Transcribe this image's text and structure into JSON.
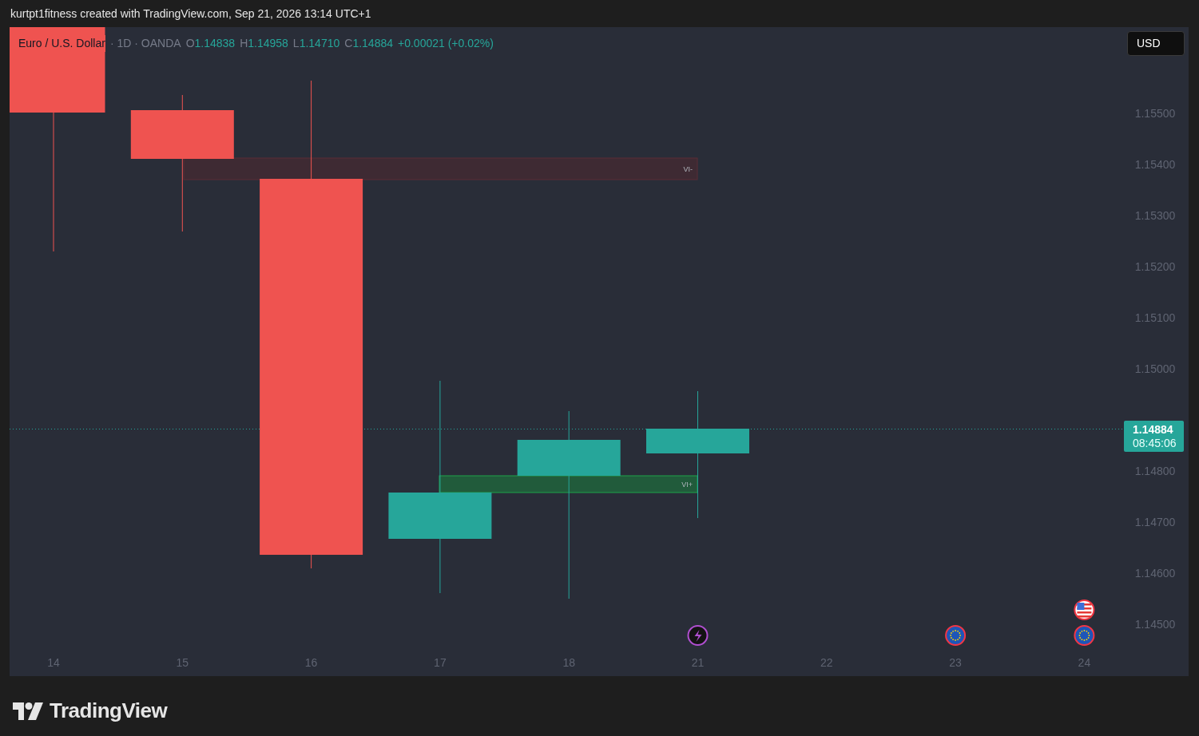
{
  "header": {
    "text": "kurtpt1fitness created with TradingView.com, Sep 21, 2026 13:14 UTC+1"
  },
  "legend": {
    "symbol": "Euro / U.S. Dollar",
    "details": "· 1D · OANDA",
    "ohlc": [
      {
        "label": "O",
        "value": "1.14838"
      },
      {
        "label": "H",
        "value": "1.14958"
      },
      {
        "label": "L",
        "value": "1.14710"
      },
      {
        "label": "C",
        "value": "1.14884"
      }
    ],
    "change": "+0.00021 (+0.02%)"
  },
  "currency_button": "USD",
  "price_label": {
    "price": "1.14884",
    "countdown": "08:45:06"
  },
  "zones": [
    {
      "label": "VI-",
      "color": "#3e2a33"
    },
    {
      "label": "VI+",
      "color": "#215b3b"
    }
  ],
  "price_axis": [
    "1.15500",
    "1.15400",
    "1.15300",
    "1.15200",
    "1.15100",
    "1.15000",
    "1.14800",
    "1.14700",
    "1.14600",
    "1.14500"
  ],
  "time_axis": [
    {
      "label": "14"
    },
    {
      "label": "15"
    },
    {
      "label": "16"
    },
    {
      "label": "17"
    },
    {
      "label": "18"
    },
    {
      "label": "21",
      "events": [
        {
          "kind": "bolt"
        }
      ]
    },
    {
      "label": "22"
    },
    {
      "label": "23",
      "events": [
        {
          "kind": "eu"
        }
      ]
    },
    {
      "label": "24",
      "events": [
        {
          "kind": "us"
        },
        {
          "kind": "eu"
        }
      ]
    }
  ],
  "footer": {
    "logo_text": "TradingView"
  }
}
